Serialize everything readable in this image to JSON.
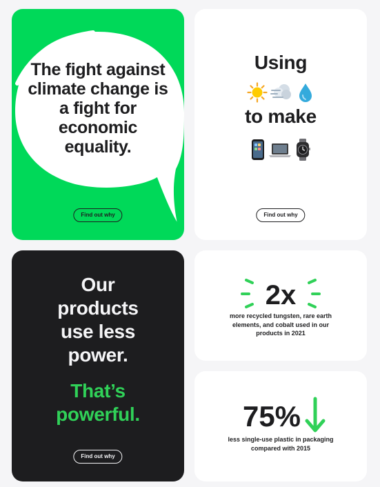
{
  "cards": {
    "fight": {
      "headline": "The fight against climate change is a fight for economic equality.",
      "cta": "Find out why"
    },
    "using": {
      "line1": "Using",
      "line2": "to make",
      "source_icons": [
        "sun-icon",
        "wind-icon",
        "water-drop-icon"
      ],
      "product_icons": [
        "iphone-icon",
        "macbook-icon",
        "apple-watch-icon"
      ],
      "cta": "Find out why"
    },
    "power": {
      "headline": [
        "Our",
        "products",
        "use less",
        "power."
      ],
      "tagline": [
        "That’s",
        "powerful."
      ],
      "cta": "Find out why"
    },
    "tungsten": {
      "stat": "2x",
      "caption": "more recycled tungsten, rare earth elements, and cobalt used in our products in 2021"
    },
    "plastic": {
      "stat": "75%",
      "caption": "less single-use plastic in packaging compared with 2015"
    }
  },
  "colors": {
    "page_bg": "#f5f5f7",
    "green": "#00d959",
    "dark": "#1d1d1f",
    "accent_green": "#30d158"
  }
}
